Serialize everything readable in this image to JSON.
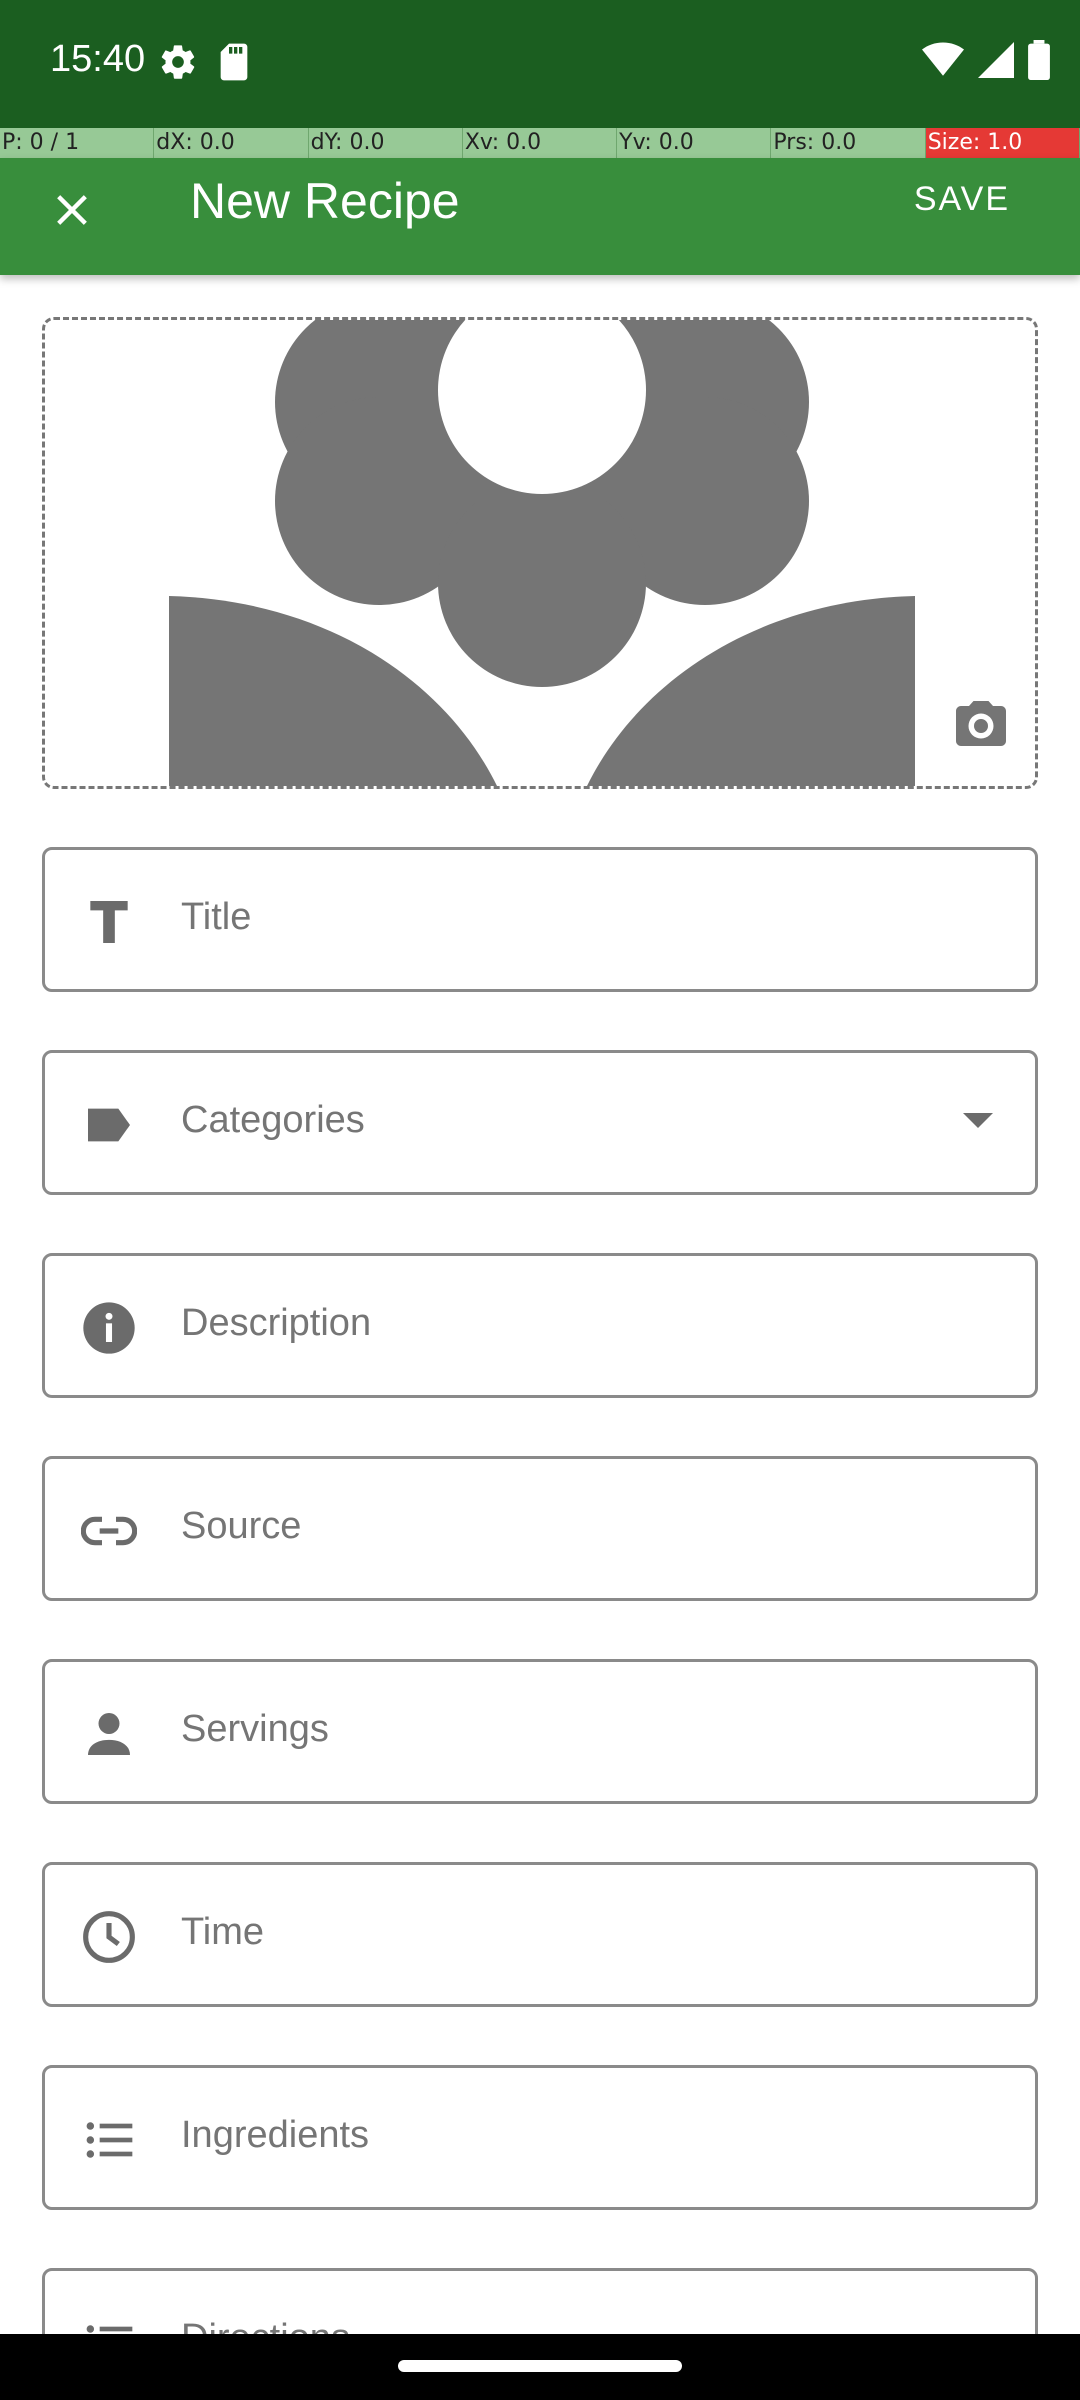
{
  "status_bar": {
    "time": "15:40",
    "icons": [
      "settings-icon",
      "sd-card-icon",
      "wifi-icon",
      "signal-icon",
      "battery-icon"
    ]
  },
  "pointer_info": {
    "p": "P: 0 / 1",
    "dx": "dX: 0.0",
    "dy": "dY: 0.0",
    "xv": "Xv: 0.0",
    "yv": "Yv: 0.0",
    "prs": "Prs: 0.0",
    "size": "Size: 1.0"
  },
  "app_bar": {
    "title": "New Recipe",
    "save_label": "SAVE"
  },
  "form": {
    "title": "Title",
    "categories": "Categories",
    "description": "Description",
    "source": "Source",
    "servings": "Servings",
    "time": "Time",
    "ingredients": "Ingredients",
    "directions": "Directions"
  },
  "colors": {
    "status_bar": "#1b5e20",
    "app_bar": "#388e3c",
    "placeholder_image": "#757575"
  }
}
